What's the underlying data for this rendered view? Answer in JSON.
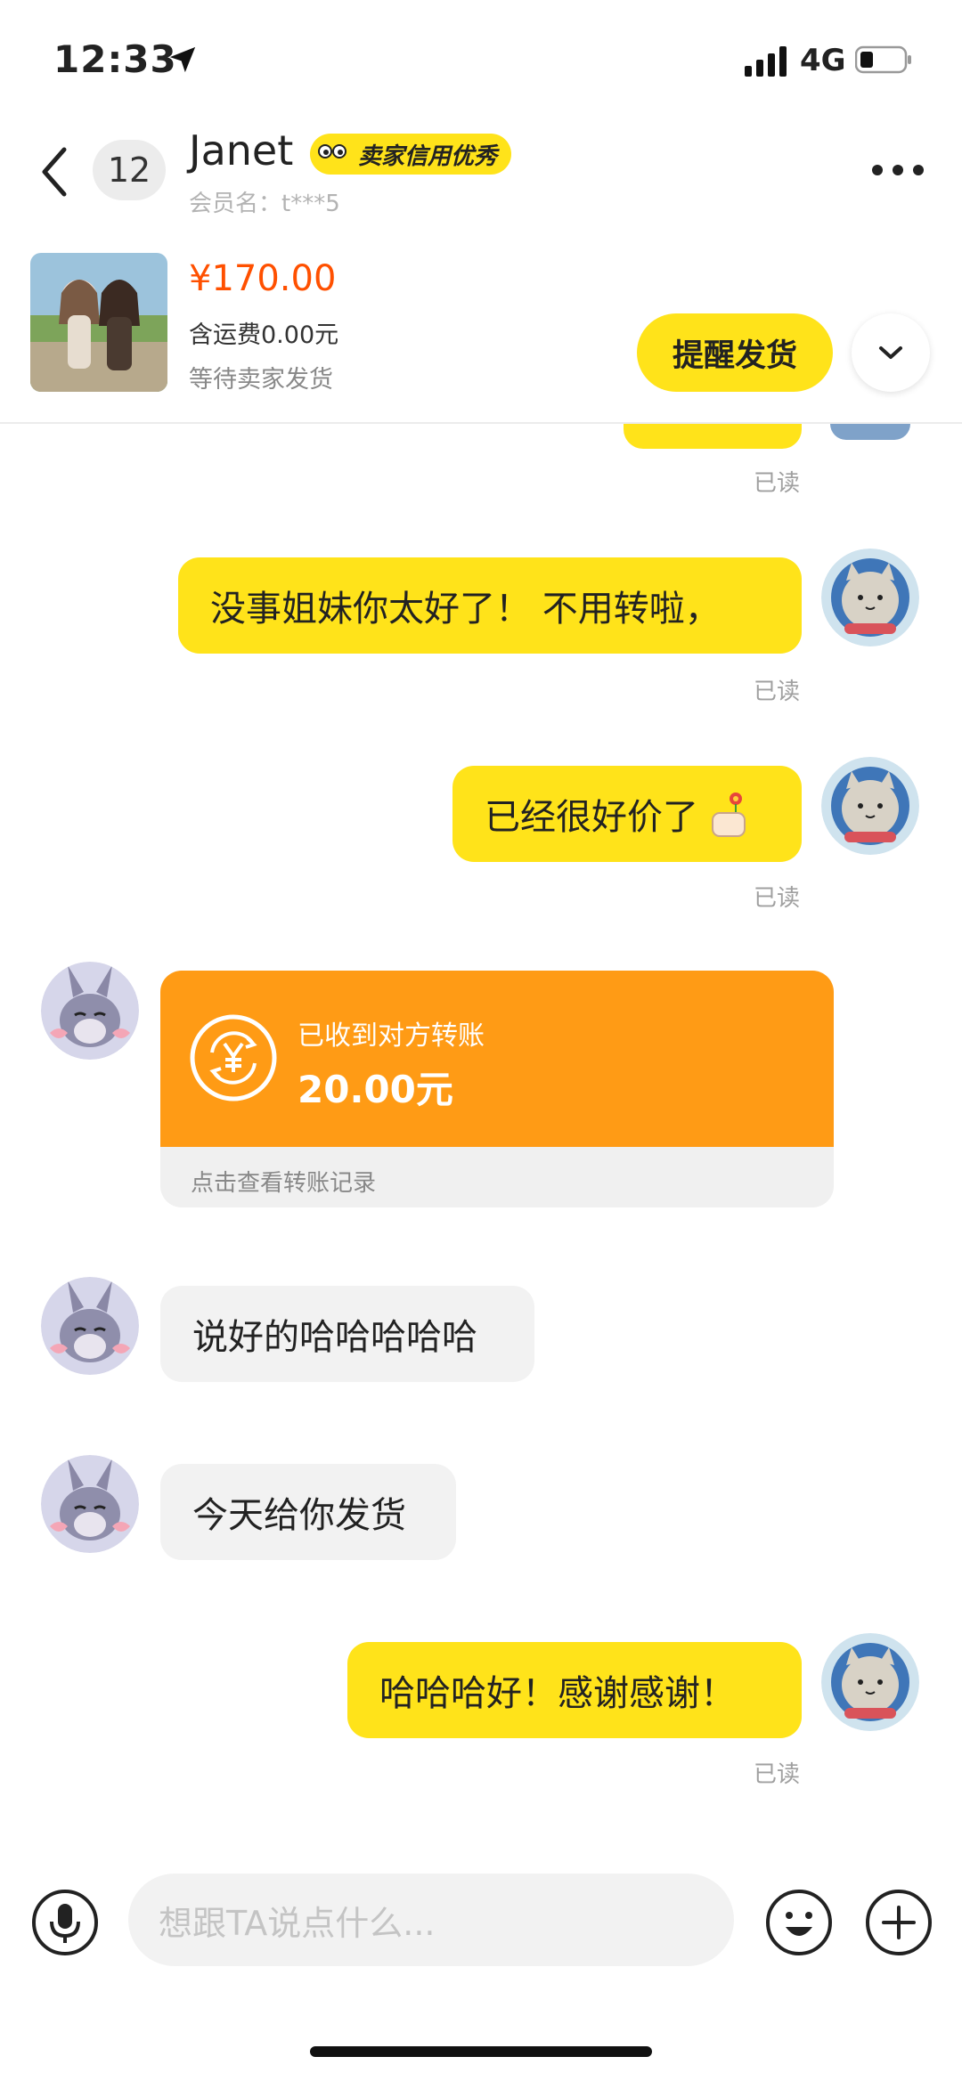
{
  "status_bar": {
    "time": "12:33",
    "network": "4G",
    "icons": [
      "location-arrow-icon",
      "signal-icon",
      "battery-icon"
    ]
  },
  "header": {
    "unread_count": "12",
    "seller_name": "Janet",
    "credit_badge": "卖家信用优秀",
    "member_label": "会员名：t***5",
    "icons": [
      "back-arrow-icon",
      "more-icon"
    ]
  },
  "order": {
    "price": "¥170.00",
    "shipping": "含运费0.00元",
    "status": "等待卖家发货",
    "remind_label": "提醒发货",
    "icons": [
      "chevron-down-icon"
    ]
  },
  "messages": {
    "read_label": "已读",
    "m1": "没事姐妹你太好了！ 不用转啦，",
    "m2": "已经很好价了",
    "m2_emoji": "thumbs-up-flower-emoji",
    "transfer": {
      "title": "已收到对方转账",
      "amount": "20.00元",
      "link": "点击查看转账记录",
      "icon": "yuan-exchange-icon"
    },
    "m3": "说好的哈哈哈哈哈",
    "m4": "今天给你发货",
    "m5": "哈哈哈好！感谢感谢！"
  },
  "input_bar": {
    "placeholder": "想跟TA说点什么...",
    "icons": [
      "microphone-icon",
      "emoji-icon",
      "plus-icon"
    ]
  },
  "colors": {
    "accent_yellow": "#ffe31a",
    "price_orange": "#ff5000",
    "transfer_orange": "#ff9b15",
    "bubble_gray": "#f2f2f2"
  }
}
